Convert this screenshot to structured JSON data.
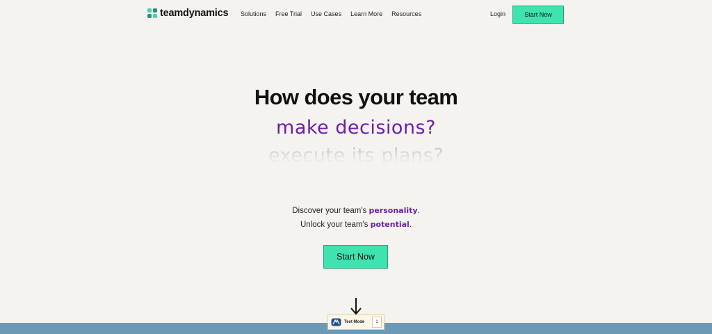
{
  "nav": {
    "logo_text": "teamdynamics",
    "links": [
      "Solutions",
      "Free Trial",
      "Use Cases",
      "Learn More",
      "Resources"
    ],
    "login_label": "Login",
    "cta_label": "Start Now"
  },
  "hero": {
    "headline": "How does your team",
    "rotator_current": "make decisions?",
    "rotator_next": "execute its plans?",
    "line1_prefix": "Discover your team's ",
    "line1_highlight": "personality",
    "line1_suffix": ".",
    "line2_prefix": "Unlock your team's ",
    "line2_highlight": "potential",
    "line2_suffix": ".",
    "cta_label": "Start Now"
  },
  "test_mode": {
    "label": "Test Mode",
    "count": "1"
  },
  "colors": {
    "accent_green": "#3fe3b0",
    "highlight_purple": "#6a1fa8",
    "background": "#f5f3ef",
    "band_blue": "#6a9ab6"
  },
  "icons": {
    "scroll": "arrow-down-icon",
    "brand": "grid-logo-icon"
  }
}
